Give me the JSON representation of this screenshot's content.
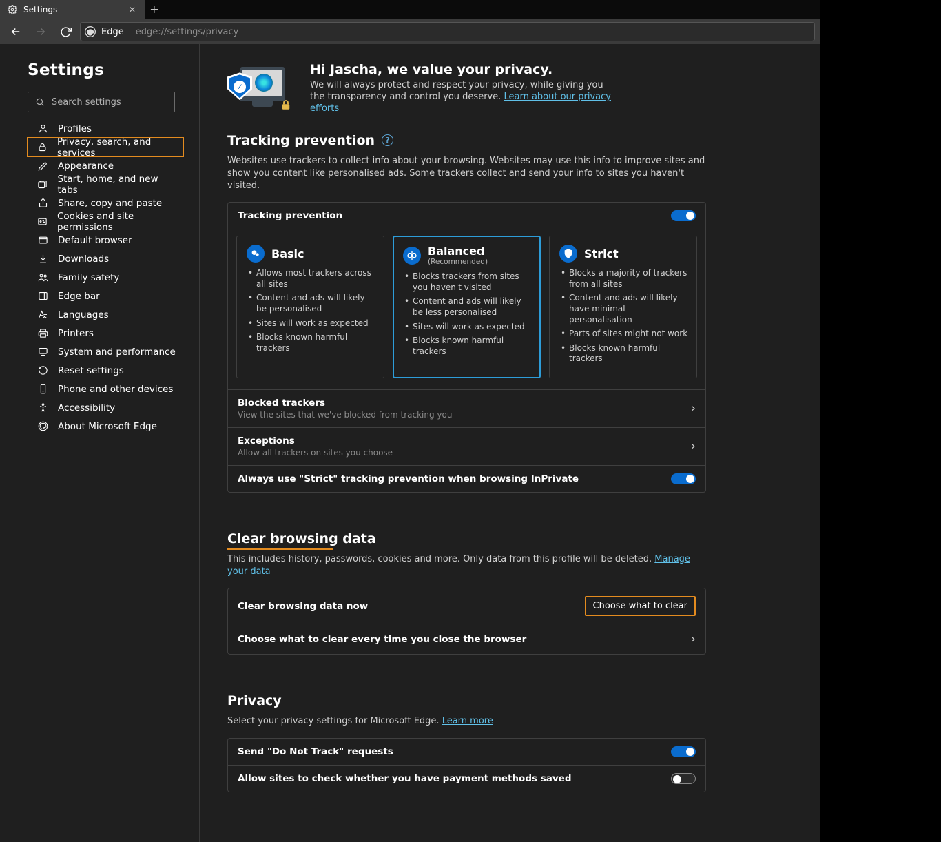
{
  "tab": {
    "title": "Settings"
  },
  "addressbar": {
    "browser_name": "Edge",
    "url": "edge://settings/privacy"
  },
  "sidebar": {
    "title": "Settings",
    "search_placeholder": "Search settings",
    "items": [
      {
        "label": "Profiles"
      },
      {
        "label": "Privacy, search, and services"
      },
      {
        "label": "Appearance"
      },
      {
        "label": "Start, home, and new tabs"
      },
      {
        "label": "Share, copy and paste"
      },
      {
        "label": "Cookies and site permissions"
      },
      {
        "label": "Default browser"
      },
      {
        "label": "Downloads"
      },
      {
        "label": "Family safety"
      },
      {
        "label": "Edge bar"
      },
      {
        "label": "Languages"
      },
      {
        "label": "Printers"
      },
      {
        "label": "System and performance"
      },
      {
        "label": "Reset settings"
      },
      {
        "label": "Phone and other devices"
      },
      {
        "label": "Accessibility"
      },
      {
        "label": "About Microsoft Edge"
      }
    ]
  },
  "hero": {
    "title": "Hi Jascha, we value your privacy.",
    "body": "We will always protect and respect your privacy, while giving you the transparency and control you deserve. ",
    "link_text": "Learn about our privacy efforts"
  },
  "tracking": {
    "title": "Tracking prevention",
    "desc": "Websites use trackers to collect info about your browsing. Websites may use this info to improve sites and show you content like personalised ads. Some trackers collect and send your info to sites you haven't visited.",
    "row_label": "Tracking prevention",
    "enabled": true,
    "cards": [
      {
        "title": "Basic",
        "color": "#0a6cce",
        "bullets": [
          "Allows most trackers across all sites",
          "Content and ads will likely be personalised",
          "Sites will work as expected",
          "Blocks known harmful trackers"
        ]
      },
      {
        "title": "Balanced",
        "subtitle": "(Recommended)",
        "color": "#0a6cce",
        "bullets": [
          "Blocks trackers from sites you haven't visited",
          "Content and ads will likely be less personalised",
          "Sites will work as expected",
          "Blocks known harmful trackers"
        ]
      },
      {
        "title": "Strict",
        "color": "#0a6cce",
        "bullets": [
          "Blocks a majority of trackers from all sites",
          "Content and ads will likely have minimal personalisation",
          "Parts of sites might not work",
          "Blocks known harmful trackers"
        ]
      }
    ],
    "blocked": {
      "label": "Blocked trackers",
      "sub": "View the sites that we've blocked from tracking you"
    },
    "exceptions": {
      "label": "Exceptions",
      "sub": "Allow all trackers on sites you choose"
    },
    "strict_inprivate": {
      "label": "Always use \"Strict\" tracking prevention when browsing InPrivate",
      "enabled": true
    }
  },
  "clear_data": {
    "title": "Clear browsing data",
    "desc_pre": "This includes history, passwords, cookies and more. Only data from this profile will be deleted. ",
    "manage_link": "Manage your data",
    "now_label": "Clear browsing data now",
    "now_button": "Choose what to clear",
    "on_close_label": "Choose what to clear every time you close the browser"
  },
  "privacy": {
    "title": "Privacy",
    "desc_pre": "Select your privacy settings for Microsoft Edge. ",
    "learn_link": "Learn more",
    "dnt": {
      "label": "Send \"Do Not Track\" requests",
      "enabled": true
    },
    "payment": {
      "label": "Allow sites to check whether you have payment methods saved",
      "enabled": false
    }
  }
}
